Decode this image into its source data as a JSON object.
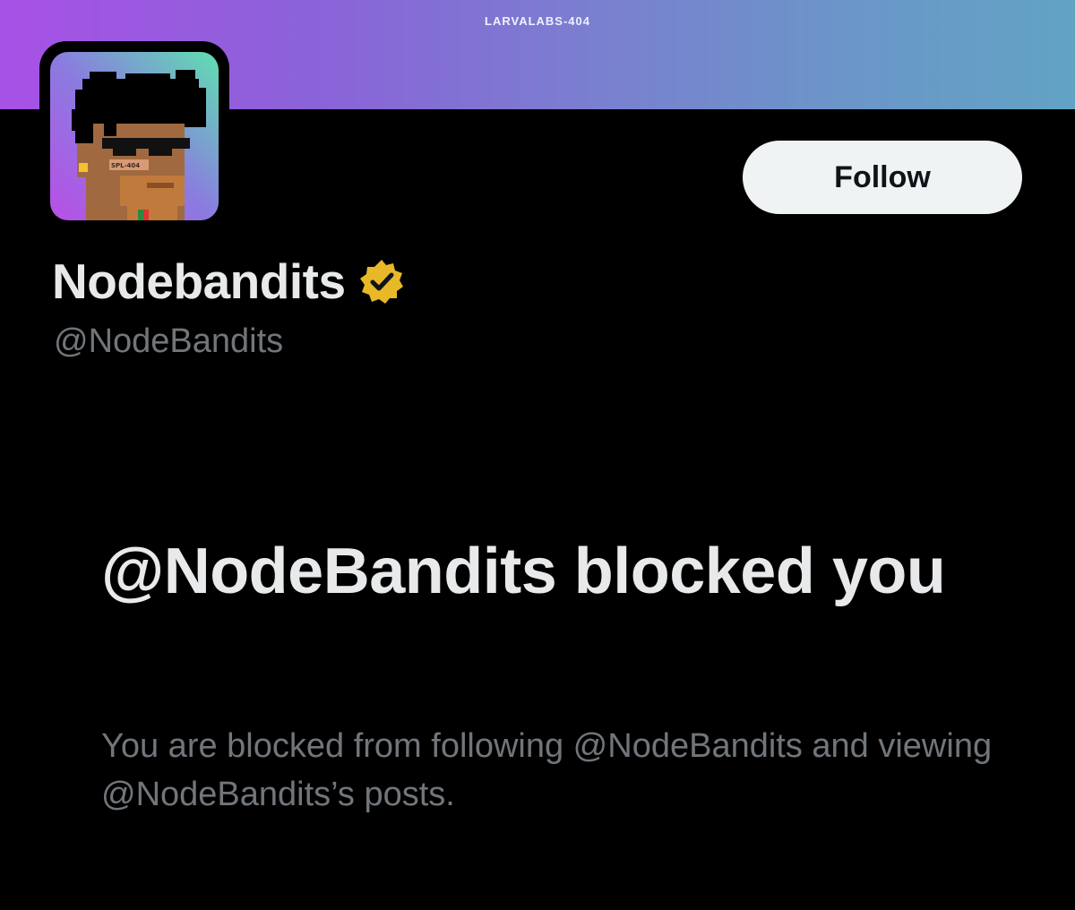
{
  "banner": {
    "text": "LARVALABS-404",
    "colors": [
      "#a751e6",
      "#7a7fd0",
      "#62a3c4"
    ]
  },
  "avatar": {
    "icon": "pixel-punk-avatar",
    "tag_text": "SPL-404"
  },
  "profile": {
    "display_name": "Nodebandits",
    "handle": "@NodeBandits",
    "verified_badge": "gold-verified-badge-icon",
    "badge_color": "#e8b829"
  },
  "actions": {
    "follow_label": "Follow"
  },
  "blocked": {
    "title": "@NodeBandits blocked you",
    "description": "You are blocked from following @NodeBandits and viewing @NodeBandits’s posts."
  }
}
